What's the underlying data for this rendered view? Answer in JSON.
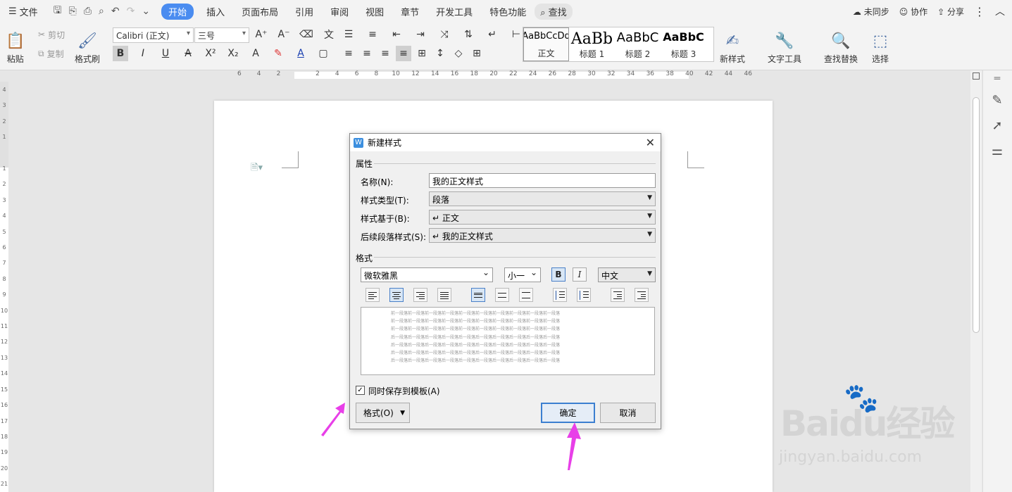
{
  "menubar": {
    "file": "文件",
    "tabs": [
      "开始",
      "插入",
      "页面布局",
      "引用",
      "审阅",
      "视图",
      "章节",
      "开发工具",
      "特色功能"
    ],
    "search": "查找",
    "right": {
      "sync": "未同步",
      "collab": "协作",
      "share": "分享"
    }
  },
  "toolbar": {
    "paste": "粘贴",
    "cut": "剪切",
    "copy": "复制",
    "format_painter": "格式刷",
    "font_name": "Calibri (正文)",
    "font_size": "三号",
    "styles": [
      {
        "preview": "AaBbCcDd",
        "label": "正文"
      },
      {
        "preview": "AaBb",
        "label": "标题 1"
      },
      {
        "preview": "AaBbC",
        "label": "标题 2"
      },
      {
        "preview": "AaBbC",
        "label": "标题 3"
      }
    ],
    "new_style": "新样式",
    "text_tools": "文字工具",
    "find_replace": "查找替换",
    "select": "选择"
  },
  "ruler": {
    "labels": [
      "6",
      "4",
      "2",
      "",
      "2",
      "4",
      "6",
      "8",
      "10",
      "12",
      "14",
      "16",
      "18",
      "20",
      "22",
      "24",
      "26",
      "28",
      "30",
      "32",
      "34",
      "36",
      "38",
      "40",
      "42",
      "44",
      "46"
    ]
  },
  "vruler": {
    "labels": [
      "4",
      "3",
      "2",
      "1",
      "",
      "1",
      "2",
      "3",
      "4",
      "5",
      "6",
      "7",
      "8",
      "9",
      "10",
      "11",
      "12",
      "13",
      "14",
      "15",
      "16",
      "17",
      "18",
      "19",
      "20",
      "21"
    ]
  },
  "dialog": {
    "title": "新建样式",
    "section_props": "属性",
    "name_label": "名称(N):",
    "name_value": "我的正文样式",
    "type_label": "样式类型(T):",
    "type_value": "段落",
    "based_label": "样式基于(B):",
    "based_value": "↵ 正文",
    "next_label": "后续段落样式(S):",
    "next_value": "↵ 我的正文样式",
    "section_format": "格式",
    "font": "微软雅黑",
    "size": "小一",
    "bold": "B",
    "italic": "I",
    "lang": "中文",
    "preview_lines": [
      "前一段落前一段落前一段落前一段落前一段落前一段落前一段落前一段落前一段落前一段落",
      "前一段落前一段落前一段落前一段落前一段落前一段落前一段落前一段落前一段落前一段落",
      "前一段落前一段落前一段落前一段落前一段落前一段落前一段落前一段落前一段落前一段落",
      "后一段落后一段落后一段落后一段落后一段落后一段落后一段落后一段落后一段落后一段落",
      "后一段落后一段落后一段落后一段落后一段落后一段落后一段落后一段落后一段落后一段落",
      "后一段落后一段落后一段落后一段落后一段落后一段落后一段落后一段落后一段落后一段落",
      "后一段落后一段落后一段落后一段落后一段落后一段落后一段落后一段落后一段落后一段落"
    ],
    "save_template": "同时保存到模板(A)",
    "format_btn": "格式(O)",
    "ok": "确定",
    "cancel": "取消"
  },
  "watermark": {
    "brand": "Baidu经验",
    "url": "jingyan.baidu.com"
  },
  "colors": {
    "accent": "#4a8cf0",
    "arrow": "#e83fe8"
  }
}
